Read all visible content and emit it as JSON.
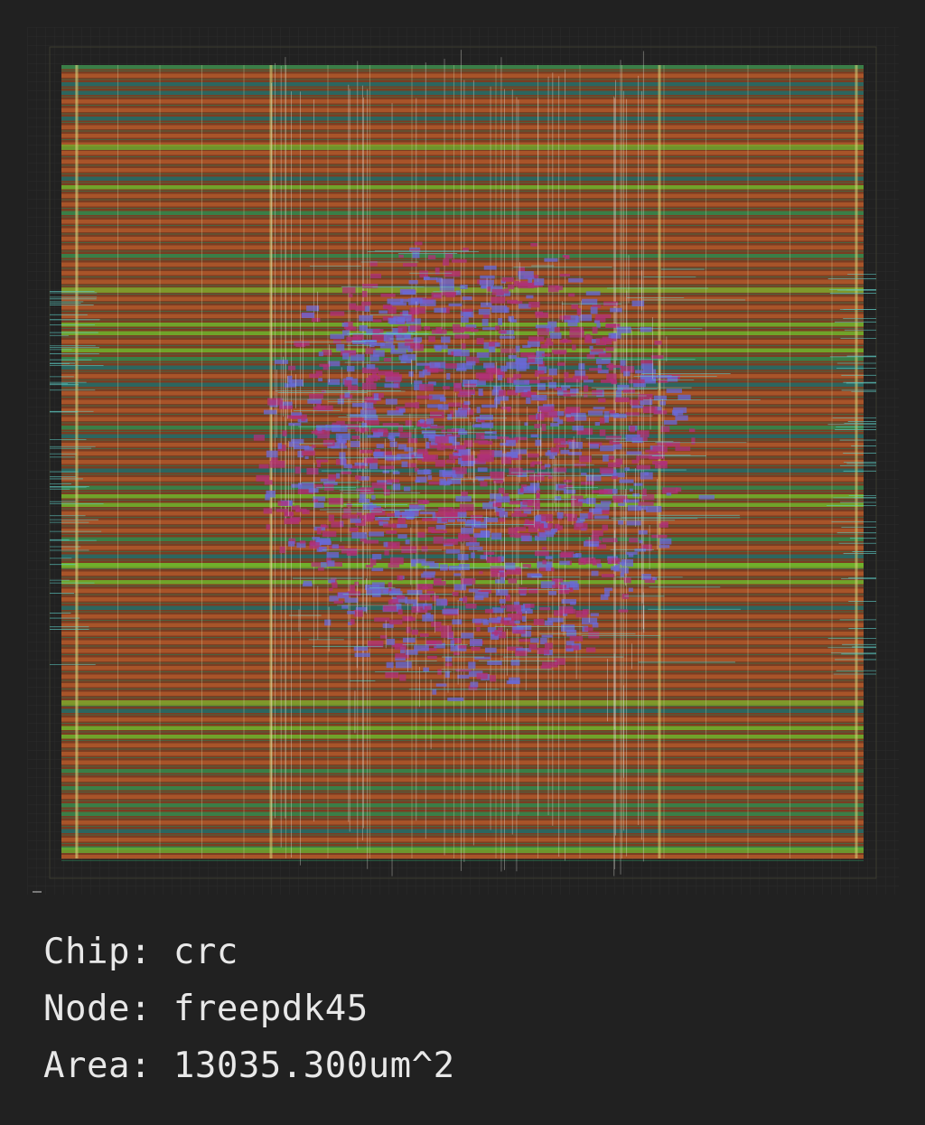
{
  "info": {
    "chip_line": "Chip: crc",
    "node_line": "Node: freepdk45",
    "area_line": "Area: 13035.300um^2"
  },
  "colors": {
    "background": "#212121",
    "metal_horizontal": "#b0582a",
    "metal_stripe_green": "#2f8a4e",
    "metal_stripe_teal": "#1f6d6a",
    "metal_stripe_bright_green": "#6fb52c",
    "power_rail": "#d8d37a",
    "cell_magenta": "#b0307a",
    "cell_blue": "#6a6ad8",
    "wire_cyan": "#5fd0c8",
    "text": "#e8e8e8"
  },
  "icons": {
    "layout": "chip-layout-image"
  }
}
